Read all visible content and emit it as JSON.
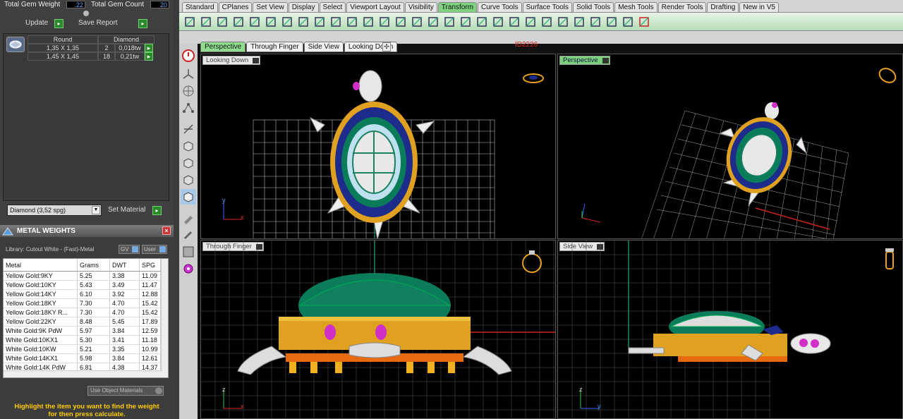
{
  "totals": {
    "weight_label": "Total Gem Weight",
    "weight_value": ".22",
    "count_label": "Total Gem Count",
    "count_value": "20"
  },
  "buttons": {
    "update": "Update",
    "save_report": "Save Report",
    "set_material": "Set Material",
    "use_object_materials": "Use Object Materials"
  },
  "gem_table": {
    "headers": [
      "Round",
      "Diamond"
    ],
    "rows": [
      [
        "1,35 X 1,35",
        "2",
        "0,018tw"
      ],
      [
        "1,45 X 1,45",
        "18",
        "0,21tw"
      ]
    ]
  },
  "material_select": "Diamond    (3,52 spg)",
  "metal_weights": {
    "title": "METAL WEIGHTS",
    "library": "Library: Cutout White - (Fast)-Metal",
    "gv_label": "GV",
    "user_label": "User",
    "headers": [
      "Metal",
      "Grams",
      "DWT",
      "SPG"
    ],
    "rows": [
      [
        "Yellow Gold:9KY",
        "5.25",
        "3.38",
        "11.09"
      ],
      [
        "Yellow Gold:10KY",
        "5.43",
        "3.49",
        "11.47"
      ],
      [
        "Yellow Gold:14KY",
        "6.10",
        "3.92",
        "12.88"
      ],
      [
        "Yellow Gold:18KY",
        "7.30",
        "4.70",
        "15.42"
      ],
      [
        "Yellow Gold:18KY R...",
        "7.30",
        "4.70",
        "15.42"
      ],
      [
        "Yellow Gold:22KY",
        "8.48",
        "5.45",
        "17.89"
      ],
      [
        "White Gold:9K PdW",
        "5.97",
        "3.84",
        "12.59"
      ],
      [
        "White Gold:10KX1",
        "5.30",
        "3.41",
        "11.18"
      ],
      [
        "White Gold:10KW",
        "5.21",
        "3.35",
        "10.99"
      ],
      [
        "White Gold:14KX1",
        "5.98",
        "3.84",
        "12.61"
      ],
      [
        "White Gold:14K PdW",
        "6.81",
        "4.38",
        "14.37"
      ]
    ]
  },
  "hint": {
    "line1": "Highlight the item you want to find the weight",
    "line2": "for then press calculate."
  },
  "toolbar_tabs": [
    "Standard",
    "CPlanes",
    "Set View",
    "Display",
    "Select",
    "Viewport Layout",
    "Visibility",
    "Transform",
    "Curve Tools",
    "Surface Tools",
    "Solid Tools",
    "Mesh Tools",
    "Render Tools",
    "Drafting",
    "New in V5"
  ],
  "active_tab": "Transform",
  "view_tabs": [
    "Perspective",
    "Through Finger",
    "Side View",
    "Looking Down"
  ],
  "id_label": "ID2226",
  "viewports": {
    "top_left": "Looking Down",
    "top_right": "Perspective",
    "bottom_left": "Through Finger",
    "bottom_right": "Side View"
  },
  "axes": {
    "x": "x",
    "y": "y",
    "z": "z"
  },
  "colors": {
    "accent_green": "#7fd37f",
    "gold": "#e0a020",
    "hint_yellow": "#ffcc00",
    "viewport_bg": "#000000"
  }
}
